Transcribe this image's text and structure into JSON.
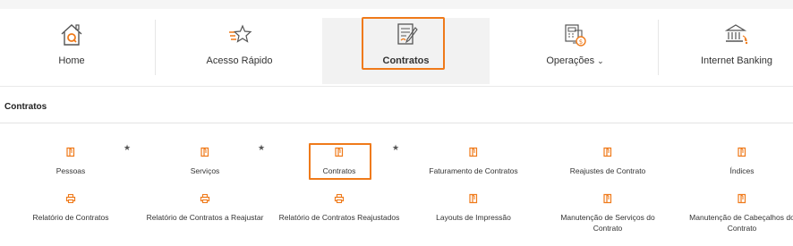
{
  "nav": {
    "items": [
      {
        "label": "Home",
        "icon": "house-icon"
      },
      {
        "label": "Acesso Rápido",
        "icon": "star-speed-icon"
      },
      {
        "label": "Contratos",
        "icon": "contract-pen-icon",
        "active": true
      },
      {
        "label": "Operações",
        "icon": "operations-icon",
        "has_dropdown": true
      },
      {
        "label": "Internet Banking",
        "icon": "bank-icon"
      }
    ]
  },
  "section": {
    "title": "Contratos"
  },
  "tiles": {
    "row1": [
      {
        "label": "Pessoas",
        "icon": "book-icon",
        "starred": true
      },
      {
        "label": "Serviços",
        "icon": "book-icon",
        "starred": true
      },
      {
        "label": "Contratos",
        "icon": "book-icon",
        "starred": true
      },
      {
        "label": "Faturamento de Contratos",
        "icon": "book-icon"
      },
      {
        "label": "Reajustes de Contrato",
        "icon": "book-icon"
      },
      {
        "label": "Índices",
        "icon": "book-icon"
      }
    ],
    "row2": [
      {
        "label": "Relatório de Contratos",
        "icon": "printer-icon"
      },
      {
        "label": "Relatório de Contratos a Reajustar",
        "icon": "printer-icon"
      },
      {
        "label": "Relatório de Contratos Reajustados",
        "icon": "printer-icon"
      },
      {
        "label": "Layouts de Impressão",
        "icon": "book-icon"
      },
      {
        "label": "Manutenção de Serviços do Contrato",
        "icon": "book-icon"
      },
      {
        "label": "Manutenção de Cabeçalhos do Contrato",
        "icon": "book-icon"
      }
    ]
  },
  "colors": {
    "accent": "#ef7a1a",
    "icon_gray": "#555555"
  }
}
